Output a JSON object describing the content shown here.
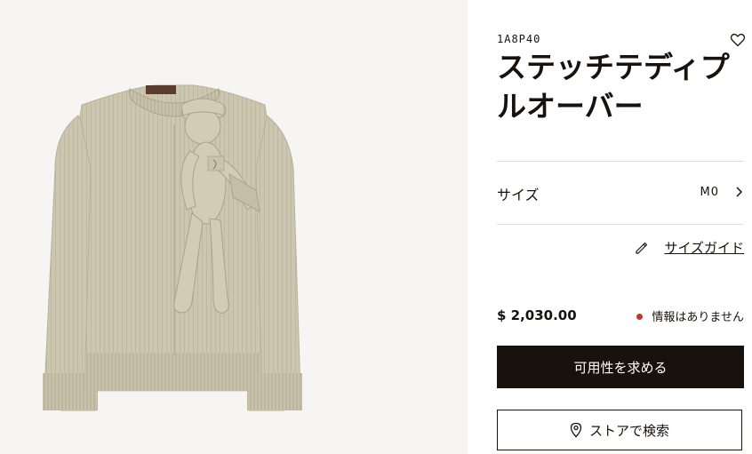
{
  "product": {
    "sku": "1A8P40",
    "title": "ステッチテディプルオーバー",
    "image_alt": "ステッチテディプルオーバー",
    "price": "$ 2,030.00",
    "stock_status": "情報はありません",
    "stock_status_color": "#c0392b"
  },
  "size_selector": {
    "label": "サイズ",
    "value": "M0"
  },
  "size_guide": {
    "label": "サイズガイド"
  },
  "actions": {
    "request_availability": "可用性を求める",
    "find_in_store": "ストアで検索"
  },
  "icons": {
    "wishlist": "heart-icon",
    "size_chevron": "chevron-right-icon",
    "size_guide": "ruler-pencil-icon",
    "store": "location-pin-icon"
  },
  "colors": {
    "brand_dark": "#19110b",
    "image_background": "#f6f5f3",
    "sweater": "#ccc6b0",
    "divider": "#e1dfdc"
  }
}
